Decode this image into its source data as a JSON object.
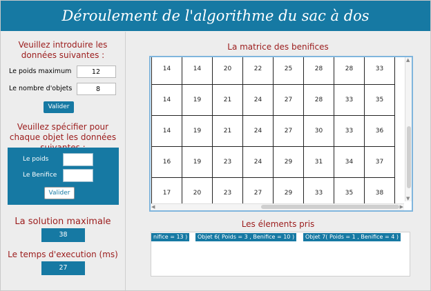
{
  "header": {
    "title": "Déroulement de l'algorithme du sac à dos"
  },
  "left": {
    "intro_title": "Veuillez introduire les données suivantes :",
    "max_weight_label": "Le poids maximum",
    "max_weight_value": "12",
    "num_objects_label": "Le nombre d'objets",
    "num_objects_value": "8",
    "validate_label": "Valider",
    "spec_title": "Veuillez spécifier pour chaque objet les données suivantes :",
    "weight_label": "Le poids",
    "benefit_label": "Le Benifice",
    "validate2_label": "Valider",
    "max_solution_title": "La solution maximale",
    "max_solution_value": "38",
    "exec_time_title": "Le temps d'execution (ms)",
    "exec_time_value": "27"
  },
  "right": {
    "matrix_title": "La matrice des benifices",
    "matrix_rows": [
      [
        "14",
        "14",
        "20",
        "22",
        "25",
        "28",
        "28",
        "33"
      ],
      [
        "14",
        "19",
        "21",
        "24",
        "27",
        "28",
        "33",
        "35"
      ],
      [
        "14",
        "19",
        "21",
        "24",
        "27",
        "30",
        "33",
        "36"
      ],
      [
        "16",
        "19",
        "23",
        "24",
        "29",
        "31",
        "34",
        "37"
      ],
      [
        "17",
        "20",
        "23",
        "27",
        "29",
        "33",
        "35",
        "38"
      ]
    ],
    "elements_title": "Les élements pris",
    "elements": [
      "nifice = 13 )",
      "Objet 6( Poids = 3 , Benifice = 10 )",
      "Objet 7( Poids = 1 , Benifice = 4 )"
    ]
  },
  "colors": {
    "accent": "#1679a3",
    "title_red": "#9b1b1b"
  }
}
